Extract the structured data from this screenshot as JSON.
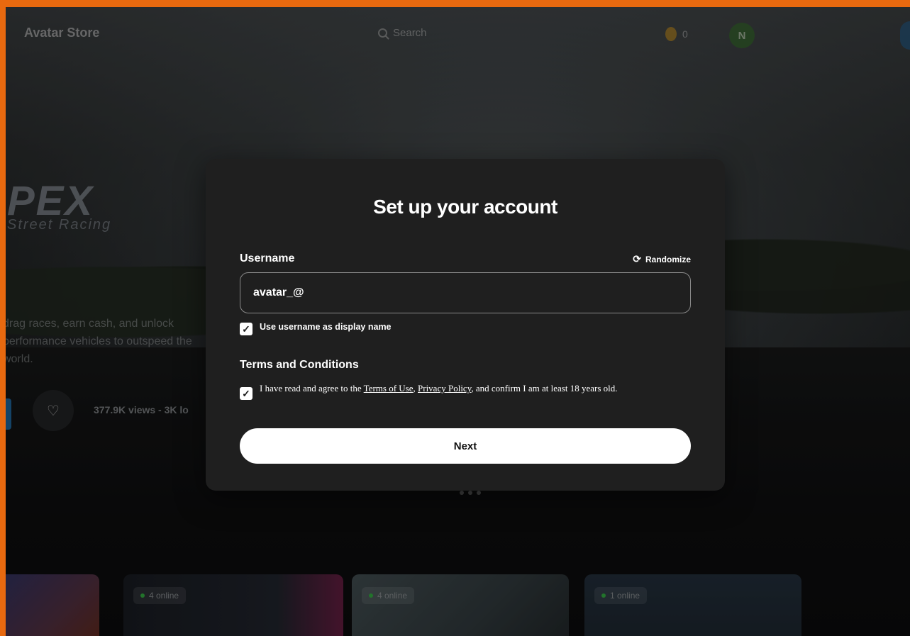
{
  "nav": {
    "brand": "Avatar Store",
    "search_placeholder": "Search",
    "coin_count": "0",
    "avatar_initial": "N"
  },
  "hero": {
    "logo_text": "PEX",
    "subtitle": "Street Racing",
    "description": "drag races, earn cash, and unlock performance vehicles to outspeed the world.",
    "stats": "377.9K views - 3K lo"
  },
  "cards": [
    {
      "online": ""
    },
    {
      "online": "4 online"
    },
    {
      "online": "4 online"
    },
    {
      "online": "1 online"
    }
  ],
  "modal": {
    "title": "Set up your account",
    "username_label": "Username",
    "randomize_label": "Randomize",
    "username_value": "avatar_@",
    "display_name_checkbox_label": "Use username as display name",
    "display_name_checked": true,
    "terms_heading": "Terms and Conditions",
    "terms_prefix": "I have read and agree to the ",
    "terms_of_use_link": "Terms of Use",
    "terms_sep": ", ",
    "privacy_link": "Privacy Policy",
    "terms_suffix": ", and confirm I am at least 18 years old.",
    "terms_checked": true,
    "next_label": "Next"
  },
  "colors": {
    "frame": "#e8690f",
    "modal_bg": "#1f1f1f",
    "button_bg": "#ffffff",
    "online_dot": "#2e9a3a"
  }
}
